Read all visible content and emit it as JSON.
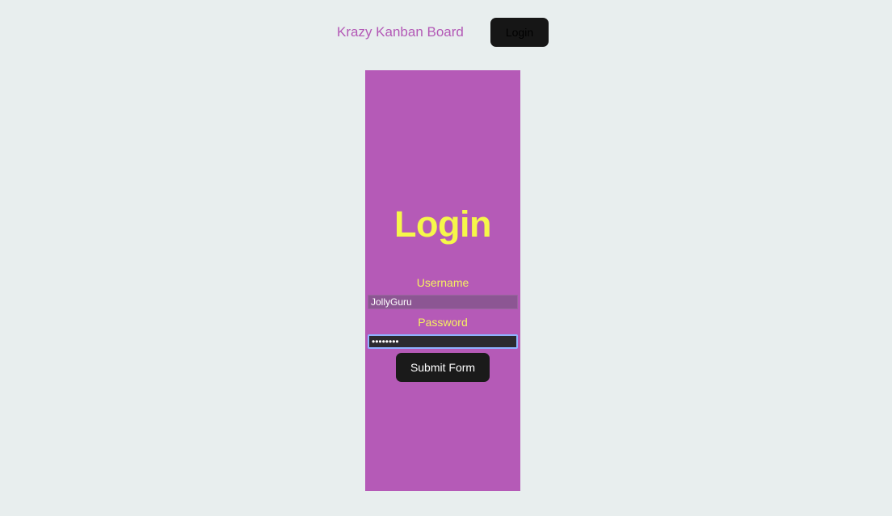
{
  "navbar": {
    "brand": "Krazy Kanban Board",
    "login_button": "Login"
  },
  "login_form": {
    "title": "Login",
    "username_label": "Username",
    "username_value": "JollyGuru",
    "password_label": "Password",
    "password_value": "••••••••",
    "submit_label": "Submit Form"
  },
  "colors": {
    "page_background": "#e8eeee",
    "brand": "#b359b6",
    "panel": "#b55ab7",
    "title": "#f6f74a",
    "label": "#f6f060",
    "button": "#1a1a1a"
  }
}
